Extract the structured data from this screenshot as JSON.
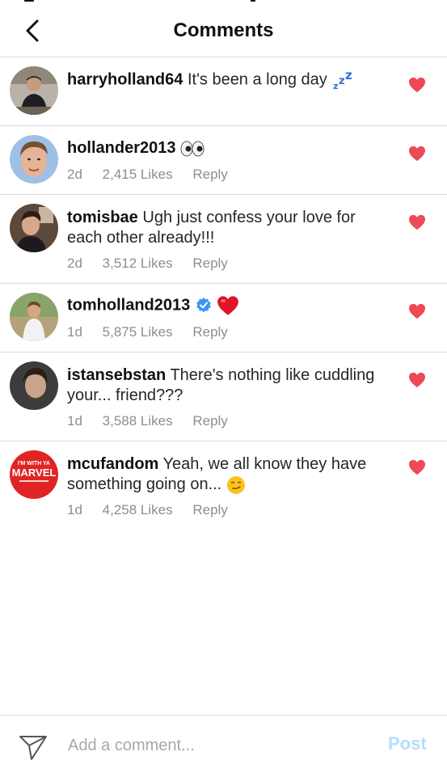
{
  "header": {
    "title": "Comments"
  },
  "comments": [
    {
      "username": "harryholland64",
      "text": "It's been a long day",
      "emoji": "zzz"
    },
    {
      "username": "hollander2013",
      "text": "",
      "emoji": "eyes",
      "age": "2d",
      "likes": "2,415 Likes",
      "reply": "Reply"
    },
    {
      "username": "tomisbae",
      "text": "Ugh just confess your love for each other already!!!",
      "age": "2d",
      "likes": "3,512 Likes",
      "reply": "Reply"
    },
    {
      "username": "tomholland2013",
      "text": "",
      "emoji": "red-heart",
      "verified": true,
      "age": "1d",
      "likes": "5,875 Likes",
      "reply": "Reply"
    },
    {
      "username": "istansebstan",
      "text": "There's nothing like cuddling your... friend???",
      "age": "1d",
      "likes": "3,588 Likes",
      "reply": "Reply"
    },
    {
      "username": "mcufandom",
      "text": "Yeah, we all know they have something going on...",
      "emoji": "smirk",
      "age": "1d",
      "likes": "4,258 Likes",
      "reply": "Reply",
      "avatar_text": [
        "I'M WITH YA",
        "MARVEL"
      ]
    }
  ],
  "footer": {
    "placeholder": "Add a comment...",
    "post_label": "Post"
  },
  "colors": {
    "like": "#ed4956",
    "post_disabled": "#b2dffc",
    "verified": "#3897f0"
  }
}
